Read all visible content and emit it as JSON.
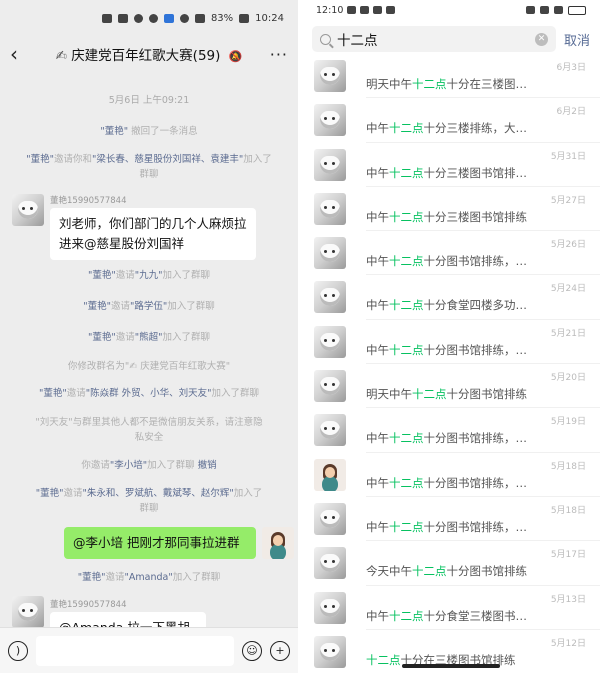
{
  "chat": {
    "status_time": "10:24",
    "status_battery": "83%",
    "title": "庆建党百年红歌大赛(59)",
    "title_pen": "✍",
    "date_divider": "5月6日 上午09:21",
    "sys": [
      {
        "n1": "\"董艳\"",
        "t1": " 撤回了一条消息",
        "n2": "",
        "t2": "",
        "n3": "",
        "t3": ""
      },
      {
        "n1": "\"董艳\"",
        "t1": "邀请你和",
        "n2": "\"梁长春、慈星股份刘国祥、袁建丰\"",
        "t2": "加入了群聊",
        "n3": "",
        "t3": ""
      }
    ],
    "sender1": "董艳15990577844",
    "bubble1_l1": "刘老师，你们部门的几个人麻烦拉",
    "bubble1_l2": "进来@慈星股份刘国祥",
    "sys2": [
      {
        "n1": "\"董艳\"",
        "t1": "邀请",
        "n2": "\"九九\"",
        "t2": "加入了群聊"
      },
      {
        "n1": "\"董艳\"",
        "t1": "邀请",
        "n2": "\"路学伍\"",
        "t2": "加入了群聊"
      },
      {
        "n1": "\"董艳\"",
        "t1": "邀请",
        "n2": "\"熊超\"",
        "t2": "加入了群聊"
      }
    ],
    "rename": "你修改群名为\"✍ 庆建党百年红歌大赛\"",
    "sys3": {
      "n1": "\"董艳\"",
      "t1": "邀请",
      "n2": "\"陈焱群 外贸、小华、刘天友\"",
      "t2": "加入了群聊"
    },
    "friend_warn_l1": "\"刘天友\"与群里其他人都不是微信朋友关系，请注意隐",
    "friend_warn_l2": "私安全",
    "invite_li": {
      "t1": "你邀请",
      "n2": "\"李小培\"",
      "t2": "加入了群聊",
      "act": "撤销"
    },
    "sys4_l1": {
      "n1": "\"董艳\"",
      "t1": "邀请",
      "n2": "\"朱永和、罗斌航、戴斌琴、赵尔辉\"",
      "t2": "加入了"
    },
    "sys4_l2": "群聊",
    "bubble2": "@李小培  把刚才那同事拉进群",
    "sys5": {
      "n1": "\"董艳\"",
      "t1": "邀请",
      "n2": "\"Amanda\"",
      "t2": "加入了群聊"
    },
    "sender2": "董艳15990577844",
    "bubble3": "@Amanda  拉一下黑胡东"
  },
  "search": {
    "status_time": "12:10",
    "query": "十二点",
    "cancel": "取消",
    "results": [
      {
        "date": "6月3日",
        "pre": "明天中午",
        "hl": "十二点",
        "post": "十分在三楼图…",
        "avatar": "cat"
      },
      {
        "date": "6月2日",
        "pre": "中午",
        "hl": "十二点",
        "post": "十分三楼排练，大…",
        "avatar": "cat"
      },
      {
        "date": "5月31日",
        "pre": "中午",
        "hl": "十二点",
        "post": "十分三楼图书馆排…",
        "avatar": "cat"
      },
      {
        "date": "5月27日",
        "pre": "中午",
        "hl": "十二点",
        "post": "十分三楼图书馆排练",
        "avatar": "cat"
      },
      {
        "date": "5月26日",
        "pre": "中午",
        "hl": "十二点",
        "post": "十分图书馆排练，…",
        "avatar": "cat"
      },
      {
        "date": "5月24日",
        "pre": "中午",
        "hl": "十二点",
        "post": "十分食堂四楼多功…",
        "avatar": "cat"
      },
      {
        "date": "5月21日",
        "pre": "中午",
        "hl": "十二点",
        "post": "十分图书馆排练，…",
        "avatar": "cat"
      },
      {
        "date": "5月20日",
        "pre": "明天中午",
        "hl": "十二点",
        "post": "十分图书馆排练",
        "avatar": "cat"
      },
      {
        "date": "5月19日",
        "pre": "中午",
        "hl": "十二点",
        "post": "十分图书馆排练，…",
        "avatar": "cat"
      },
      {
        "date": "5月18日",
        "pre": "中午",
        "hl": "十二点",
        "post": "十分图书馆排练，…",
        "avatar": "lady"
      },
      {
        "date": "5月18日",
        "pre": "中午",
        "hl": "十二点",
        "post": "十分图书馆排练，…",
        "avatar": "cat"
      },
      {
        "date": "5月17日",
        "pre": "今天中午",
        "hl": "十二点",
        "post": "十分图书馆排练",
        "avatar": "cat"
      },
      {
        "date": "5月13日",
        "pre": "中午",
        "hl": "十二点",
        "post": "十分食堂三楼图书…",
        "avatar": "cat"
      },
      {
        "date": "5月12日",
        "pre": "",
        "hl": "十二点",
        "post": "十分在三楼图书馆排练",
        "avatar": "cat"
      }
    ]
  }
}
